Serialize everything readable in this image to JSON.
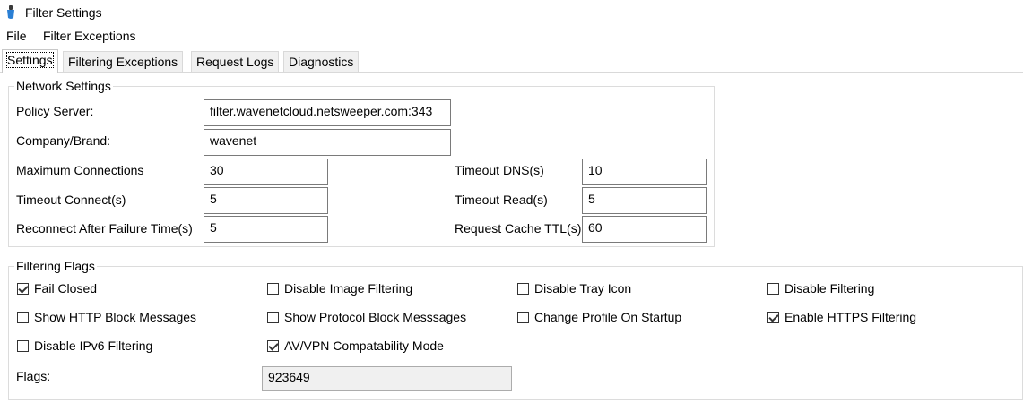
{
  "window": {
    "title": "Filter Settings",
    "icon": "app-icon"
  },
  "menu": {
    "items": [
      "File",
      "Filter Exceptions"
    ]
  },
  "tabs": [
    {
      "label": "Settings",
      "active": true
    },
    {
      "label": "Filtering Exceptions",
      "active": false
    },
    {
      "label": "Request Logs",
      "active": false
    },
    {
      "label": "Diagnostics",
      "active": false
    }
  ],
  "network_settings": {
    "legend": "Network Settings",
    "policy_server": {
      "label": "Policy Server:",
      "value": "filter.wavenetcloud.netsweeper.com:343"
    },
    "company_brand": {
      "label": "Company/Brand:",
      "value": "wavenet"
    },
    "max_connections": {
      "label": "Maximum Connections",
      "value": "30"
    },
    "timeout_connect": {
      "label": "Timeout Connect(s)",
      "value": "5"
    },
    "reconnect_after_failure": {
      "label": "Reconnect After Failure Time(s)",
      "value": "5"
    },
    "timeout_dns": {
      "label": "Timeout DNS(s)",
      "value": "10"
    },
    "timeout_read": {
      "label": "Timeout Read(s)",
      "value": "5"
    },
    "request_cache_ttl": {
      "label": "Request Cache TTL(s)",
      "value": "60"
    }
  },
  "filtering_flags": {
    "legend": "Filtering Flags",
    "checkboxes": [
      {
        "label": "Fail Closed",
        "checked": true
      },
      {
        "label": "Disable Image Filtering",
        "checked": false
      },
      {
        "label": "Disable Tray Icon",
        "checked": false
      },
      {
        "label": "Disable Filtering",
        "checked": false
      },
      {
        "label": "Show HTTP Block Messages",
        "checked": false
      },
      {
        "label": "Show Protocol Block Messsages",
        "checked": false
      },
      {
        "label": "Change Profile On Startup",
        "checked": false
      },
      {
        "label": "Enable HTTPS Filtering",
        "checked": true
      },
      {
        "label": "Disable IPv6 Filtering",
        "checked": false
      },
      {
        "label": "AV/VPN Compatability Mode",
        "checked": true
      }
    ],
    "flags": {
      "label": "Flags:",
      "value": "923649"
    }
  },
  "colors": {
    "icon_blue": "#2a7fd4",
    "icon_dark": "#3a3a3a"
  }
}
